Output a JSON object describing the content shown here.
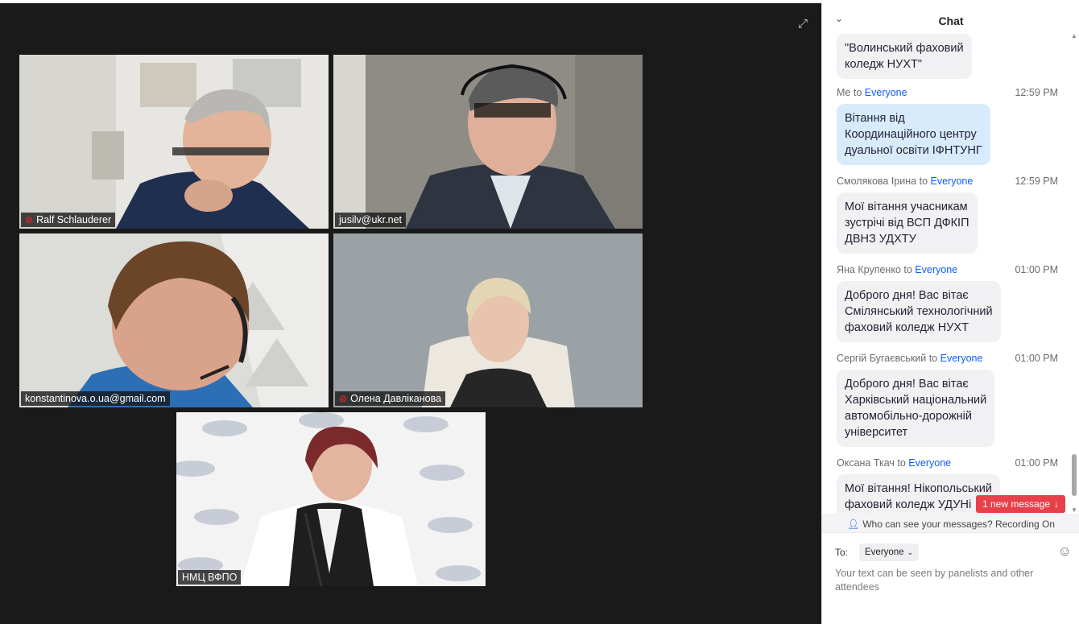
{
  "gallery": {
    "expand_icon": "expand-icon",
    "tiles": [
      {
        "name": "Ralf Schlauderer",
        "muted": true
      },
      {
        "name": "jusilv@ukr.net",
        "muted": false
      },
      {
        "name": "konstantinova.o.ua@gmail.com",
        "muted": false
      },
      {
        "name": "Олена Давліканова",
        "muted": true
      },
      {
        "name": "НМЦ ВФПО",
        "muted": false
      }
    ]
  },
  "chat": {
    "title": "Chat",
    "messages": [
      {
        "sender": "",
        "to_word": "",
        "recipient": "",
        "time": "",
        "text": "\"Волинський фаховий\nколедж НУХТ\"",
        "mine": false
      },
      {
        "sender": "Me",
        "to_word": "to",
        "recipient": "Everyone",
        "time": "12:59 PM",
        "text": "Вітання від\nКоординаційного центру\nдуальної освіти ІФНТУНГ",
        "mine": true
      },
      {
        "sender": "Смолякова Ірина",
        "to_word": "to",
        "recipient": "Everyone",
        "time": "12:59 PM",
        "text": "Мої вітання учасникам\nзустрічі від ВСП ДФКІП\nДВНЗ УДХТУ",
        "mine": false
      },
      {
        "sender": "Яна Крупенко",
        "to_word": "to",
        "recipient": "Everyone",
        "time": "01:00 PM",
        "text": "Доброго дня! Вас вітає\nСмілянський технологічний\nфаховий коледж НУХТ",
        "mine": false
      },
      {
        "sender": "Сергій Бугаєвський",
        "to_word": "to",
        "recipient": "Everyone",
        "time": "01:00 PM",
        "text": "Доброго дня! Вас вітає\nХарківський національний\nавтомобільно-дорожній\nуніверситет",
        "mine": false
      },
      {
        "sender": "Оксана Ткач",
        "to_word": "to",
        "recipient": "Everyone",
        "time": "01:00 PM",
        "text": "Мої вітання! Нікопольський\nфаховий коледж УДУНі",
        "mine": false
      }
    ],
    "new_message_label": "1 new message",
    "visibility_text": "Who can see your messages? Recording On",
    "to_label": "To:",
    "to_value": "Everyone",
    "input_placeholder": "Your text can be seen by panelists and other attendees"
  }
}
